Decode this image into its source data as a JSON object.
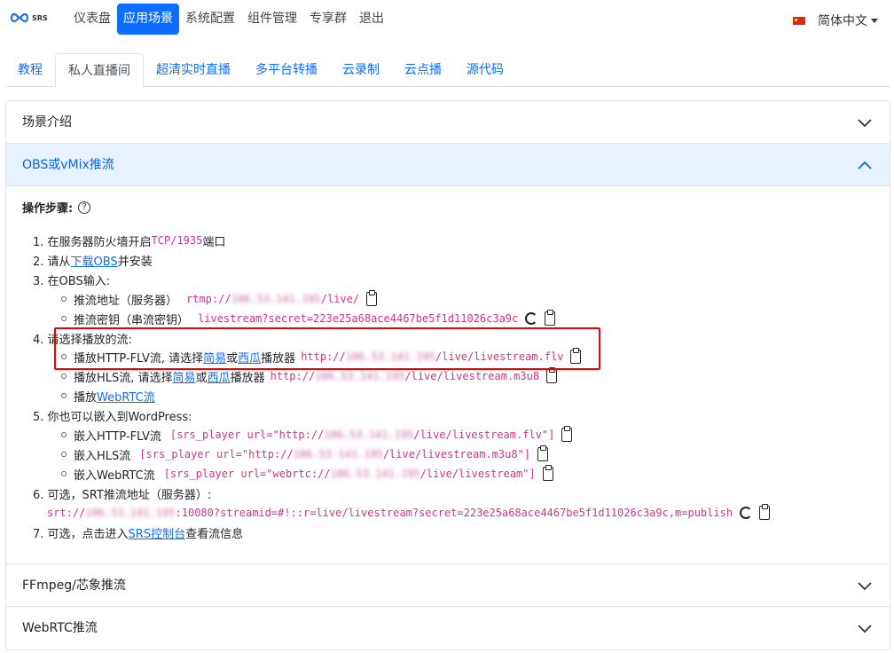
{
  "nav": {
    "brand": "SRS",
    "items": [
      "仪表盘",
      "应用场景",
      "系统配置",
      "组件管理",
      "专享群",
      "退出"
    ],
    "active": 1,
    "lang": "简体中文"
  },
  "tabs": [
    "教程",
    "私人直播间",
    "超清实时直播",
    "多平台转播",
    "云录制",
    "云点播",
    "源代码"
  ],
  "accordion": {
    "h1": "场景介绍",
    "h2": "OBS或vMix推流",
    "h3": "FFmpeg/芯象推流",
    "h4": "WebRTC推流",
    "steps_title": "操作步骤:",
    "help": "?",
    "s1_pre": "1. 在服务器防火墙开启",
    "s1_code": "TCP/1935",
    "s1_post": "端口",
    "s2_pre": "2. 请从",
    "s2_link": "下载OBS",
    "s2_post": "并安装",
    "s3": "3. 在OBS输入:",
    "s3a_label": "推流地址（服务器）",
    "s3a_c1": "rtmp://",
    "s3a_ip": "106.53.141.195",
    "s3a_c2": "/live/",
    "s3b_label": "推流密钥（串流密钥）",
    "s3b_code": "livestream?secret=223e25a68ace4467be5f1d11026c3a9c",
    "s4": "4. 请选择播放的流:",
    "s4a_pre": "播放HTTP-FLV流, 请选择",
    "s4a_l1": "简易",
    "s4a_or": "或",
    "s4a_l2": "西瓜",
    "s4a_post": "播放器",
    "s4a_c1": "http://",
    "s4a_ip": "106.53.141.195",
    "s4a_c2": "/live/livestream.flv",
    "s4b_pre": "播放HLS流, 请选择",
    "s4b_l1": "简易",
    "s4b_or": "或",
    "s4b_l2": "西瓜",
    "s4b_post": "播放器",
    "s4b_c1": "http://",
    "s4b_ip": "106.53.141.195",
    "s4b_c2": "/live/livestream.m3u8",
    "s4c_pre": "播放",
    "s4c_link": "WebRTC流",
    "s5": "5. 你也可以嵌入到WordPress:",
    "s5a_label": "嵌入HTTP-FLV流",
    "s5a_c1": "[srs_player url=\"http://",
    "s5a_ip": "106.53.141.195",
    "s5a_c2": "/live/livestream.flv\"]",
    "s5b_label": "嵌入HLS流",
    "s5b_c1": "[srs_player url=\"http://",
    "s5b_ip": "106.53.141.195",
    "s5b_c2": "/live/livestream.m3u8\"]",
    "s5c_label": "嵌入WebRTC流",
    "s5c_c1": "[srs_player url=\"webrtc://",
    "s5c_ip": "106.53.141.195",
    "s5c_c2": "/live/livestream\"]",
    "s6": "6. 可选，SRT推流地址（服务器）:",
    "s6_c1": "srt://",
    "s6_ip": "106.53.141.195",
    "s6_c2": ":10080?streamid=#!::r=live/livestream?secret=223e25a68ace4467be5f1d11026c3a9c,m=publish",
    "s7_pre": "7. 可选，点击进入",
    "s7_link": "SRS控制台",
    "s7_post": "查看流信息"
  }
}
